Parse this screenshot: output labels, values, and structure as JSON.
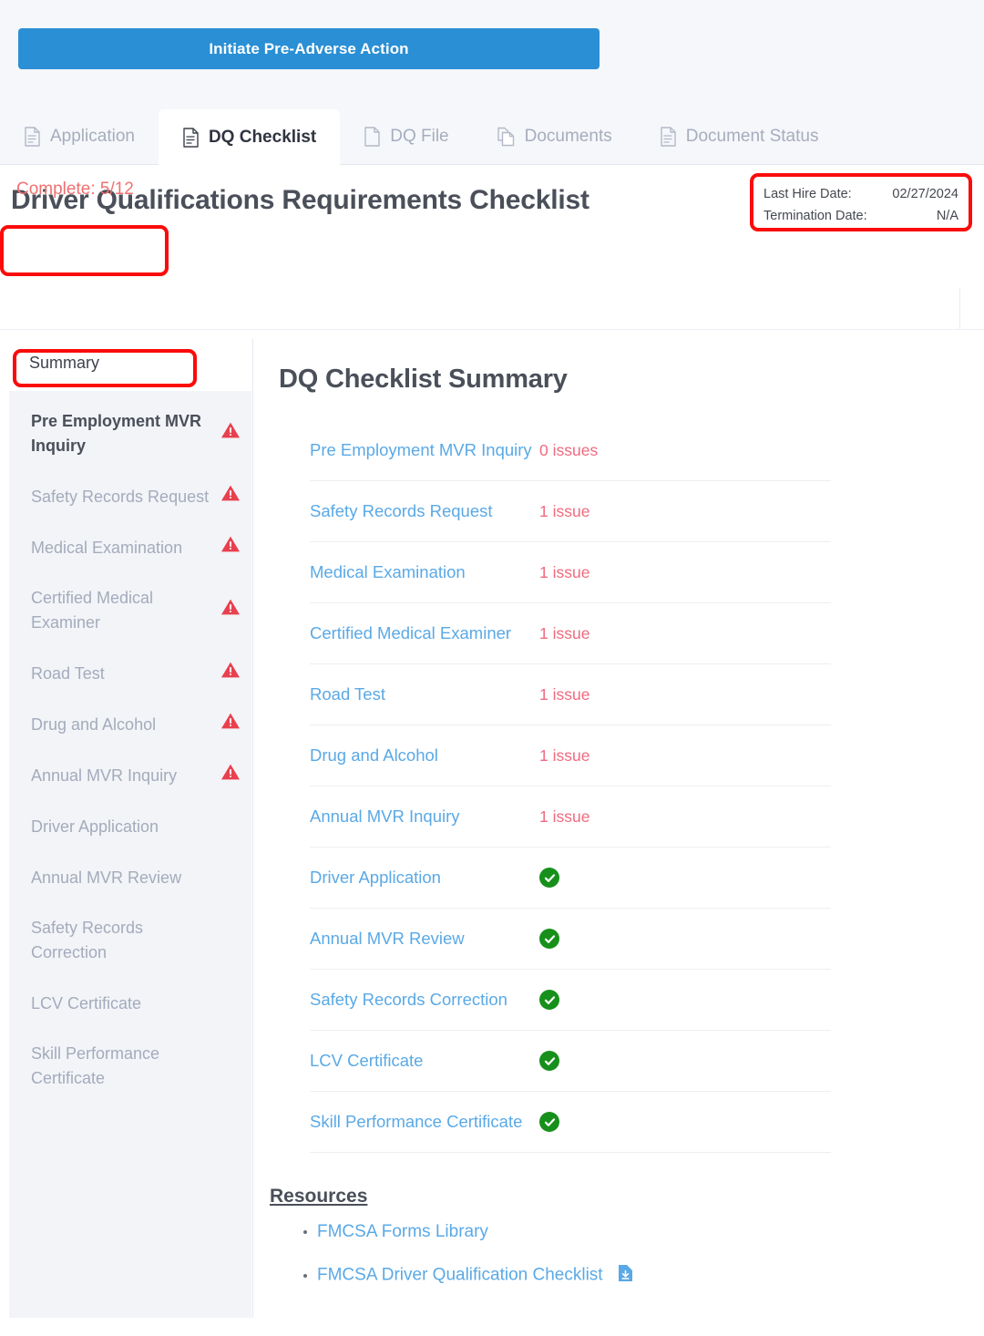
{
  "toolbar": {
    "primary_action_label": "Initiate Pre-Adverse Action"
  },
  "tabs": [
    {
      "label": "Application",
      "icon": "document-lines-icon",
      "active": false
    },
    {
      "label": "DQ Checklist",
      "icon": "document-lines-icon",
      "active": true
    },
    {
      "label": "DQ File",
      "icon": "file-blank-icon",
      "active": false
    },
    {
      "label": "Documents",
      "icon": "copy-documents-icon",
      "active": false
    },
    {
      "label": "Document Status",
      "icon": "document-lines-icon",
      "active": false
    }
  ],
  "header": {
    "page_title": "Driver Qualifications Requirements Checklist",
    "complete_label": "Complete: 5/12",
    "last_hire_date_label": "Last Hire Date:",
    "last_hire_date_value": "02/27/2024",
    "termination_date_label": "Termination Date:",
    "termination_date_value": "N/A"
  },
  "sidebar": {
    "summary_label": "Summary",
    "items": [
      {
        "label": "Pre Employment MVR Inquiry",
        "warning": true,
        "current": true
      },
      {
        "label": "Safety Records Request",
        "warning": true,
        "current": false
      },
      {
        "label": "Medical Examination",
        "warning": true,
        "current": false
      },
      {
        "label": "Certified Medical Examiner",
        "warning": true,
        "current": false
      },
      {
        "label": "Road Test",
        "warning": true,
        "current": false
      },
      {
        "label": "Drug and Alcohol",
        "warning": true,
        "current": false
      },
      {
        "label": "Annual MVR Inquiry",
        "warning": true,
        "current": false
      },
      {
        "label": "Driver Application",
        "warning": false,
        "current": false
      },
      {
        "label": "Annual MVR Review",
        "warning": false,
        "current": false
      },
      {
        "label": "Safety Records Correction",
        "warning": false,
        "current": false
      },
      {
        "label": "LCV Certificate",
        "warning": false,
        "current": false
      },
      {
        "label": "Skill Performance Certificate",
        "warning": false,
        "current": false
      }
    ]
  },
  "main": {
    "title": "DQ Checklist Summary",
    "rows": [
      {
        "name": "Pre Employment MVR Inquiry",
        "status": "0 issues",
        "complete": false
      },
      {
        "name": "Safety Records Request",
        "status": "1 issue",
        "complete": false
      },
      {
        "name": "Medical Examination",
        "status": "1 issue",
        "complete": false
      },
      {
        "name": "Certified Medical Examiner",
        "status": "1 issue",
        "complete": false
      },
      {
        "name": "Road Test",
        "status": "1 issue",
        "complete": false
      },
      {
        "name": "Drug and Alcohol",
        "status": "1 issue",
        "complete": false
      },
      {
        "name": "Annual MVR Inquiry",
        "status": "1 issue",
        "complete": false
      },
      {
        "name": "Driver Application",
        "status": "",
        "complete": true
      },
      {
        "name": "Annual MVR Review",
        "status": "",
        "complete": true
      },
      {
        "name": "Safety Records Correction",
        "status": "",
        "complete": true
      },
      {
        "name": "LCV Certificate",
        "status": "",
        "complete": true
      },
      {
        "name": "Skill Performance Certificate",
        "status": "",
        "complete": true
      }
    ],
    "resources_title": "Resources",
    "resources": [
      {
        "label": "FMCSA Forms Library",
        "download": false
      },
      {
        "label": "FMCSA Driver Qualification Checklist",
        "download": true
      }
    ]
  },
  "colors": {
    "primary_button": "#2a8fd4",
    "link": "#5aa9e6",
    "issue_text": "#ef6a7e",
    "annotation_outline": "#fb0b0b",
    "complete_text": "#f07171",
    "warning_icon": "#e8404f",
    "success_icon": "#17901b",
    "sidebar_bg": "#f2f4f8",
    "topbar_bg": "#f5f7fa"
  }
}
